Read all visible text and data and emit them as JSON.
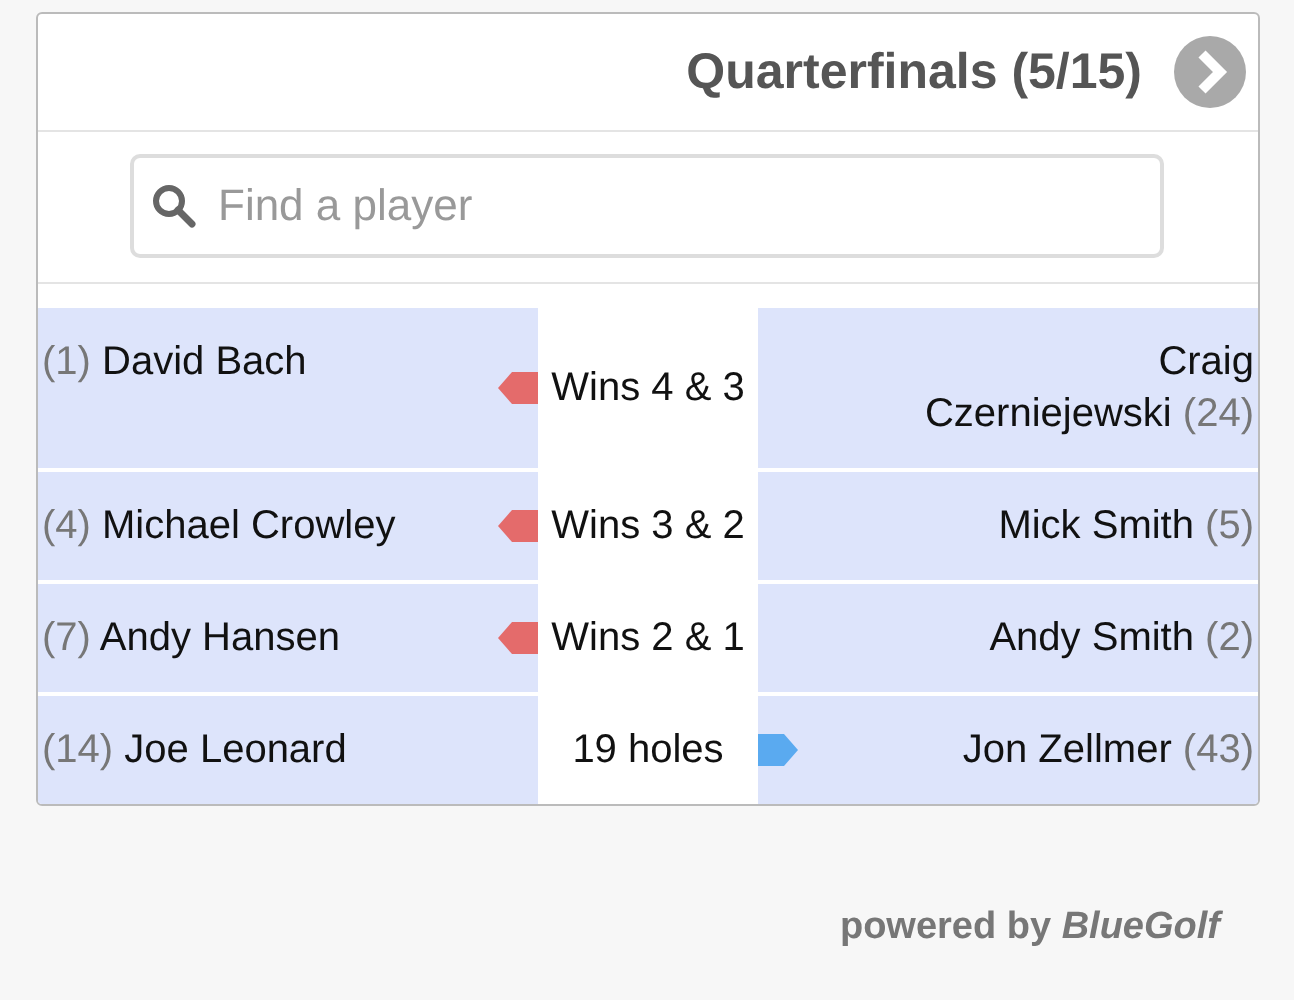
{
  "header": {
    "title": "Quarterfinals (5/15)"
  },
  "search": {
    "placeholder": "Find a player"
  },
  "matches": [
    {
      "left": {
        "seed": "(1)",
        "name": "David Bach",
        "won": true
      },
      "result": "Wins 4 & 3",
      "color": "#e46b6b",
      "right": {
        "name": "Craig Czerniejewski",
        "seed": "(24)",
        "won": false
      }
    },
    {
      "left": {
        "seed": "(4)",
        "name": "Michael Crowley",
        "won": true
      },
      "result": "Wins 3 & 2",
      "color": "#e46b6b",
      "right": {
        "name": "Mick Smith",
        "seed": "(5)",
        "won": false
      }
    },
    {
      "left": {
        "seed": "(7)",
        "name": "Andy Hansen",
        "won": true
      },
      "result": "Wins 2 & 1",
      "color": "#e46b6b",
      "right": {
        "name": "Andy Smith",
        "seed": "(2)",
        "won": false
      }
    },
    {
      "left": {
        "seed": "(14)",
        "name": "Joe Leonard",
        "won": false
      },
      "result": "19 holes",
      "color": "#5aaaf0",
      "right": {
        "name": "Jon Zellmer",
        "seed": "(43)",
        "won": true
      }
    }
  ],
  "footer": {
    "text": "powered by *BlueGolf*"
  }
}
